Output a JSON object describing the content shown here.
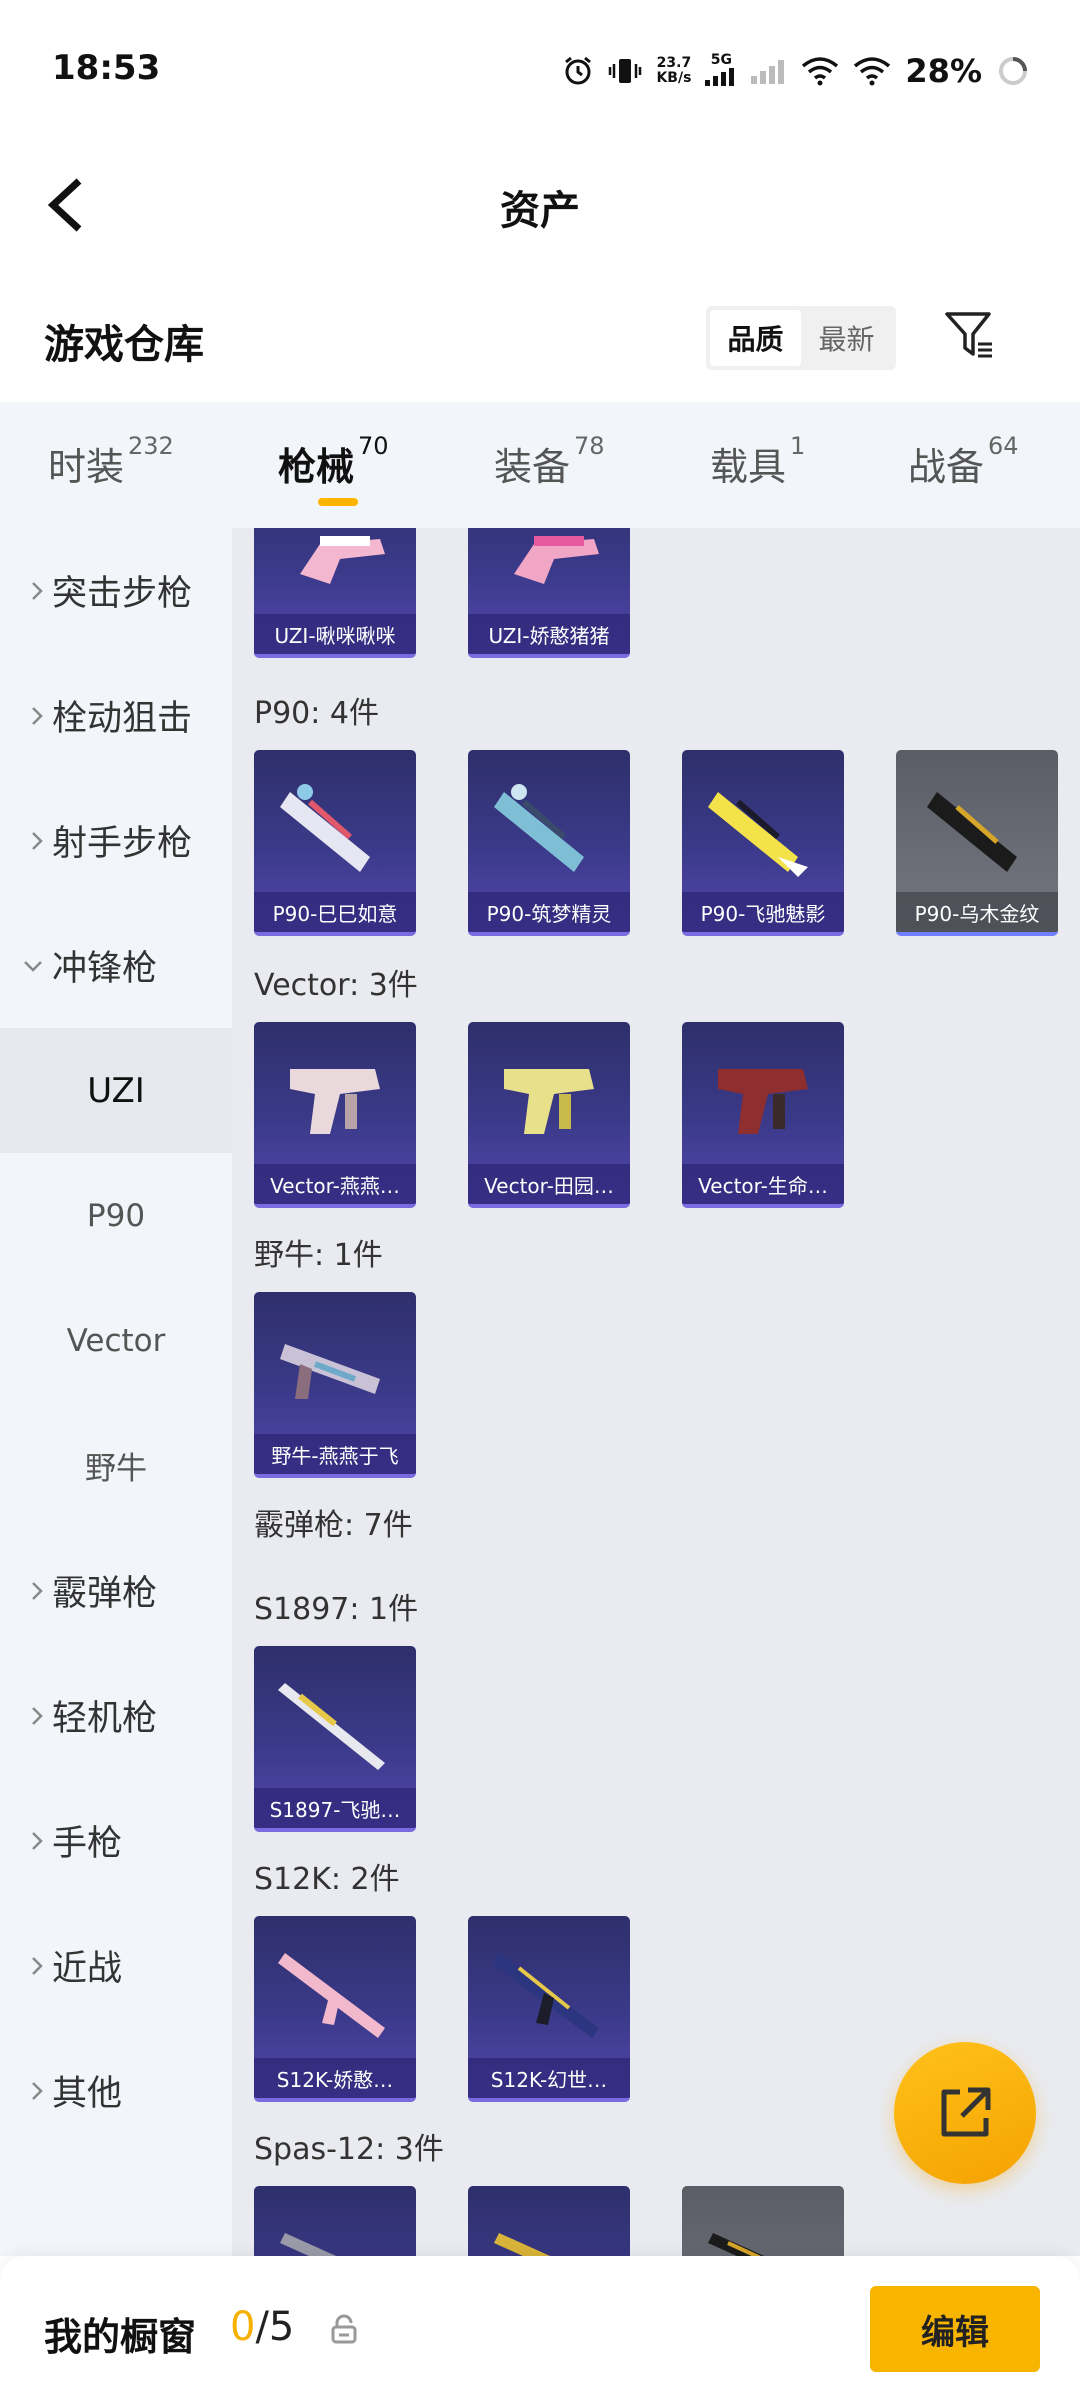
{
  "status": {
    "time": "18:53",
    "speed_value": "23.7",
    "speed_unit": "KB/s",
    "network": "5G",
    "battery": "28%"
  },
  "header": {
    "title": "资产"
  },
  "section": {
    "title": "游戏仓库",
    "sort_options": [
      "品质",
      "最新"
    ],
    "sort_selected": "品质"
  },
  "tabs": [
    {
      "label": "时装",
      "count": "232"
    },
    {
      "label": "枪械",
      "count": "70"
    },
    {
      "label": "装备",
      "count": "78"
    },
    {
      "label": "载具",
      "count": "1"
    },
    {
      "label": "战备",
      "count": "64"
    }
  ],
  "active_tab": "枪械",
  "sidebar": {
    "items": [
      {
        "label": "突击步枪"
      },
      {
        "label": "栓动狙击"
      },
      {
        "label": "射手步枪"
      },
      {
        "label": "冲锋枪"
      },
      {
        "label": "霰弹枪"
      },
      {
        "label": "轻机枪"
      },
      {
        "label": "手枪"
      },
      {
        "label": "近战"
      },
      {
        "label": "其他"
      }
    ],
    "subitems": [
      "UZI",
      "P90",
      "Vector",
      "野牛"
    ],
    "active_sub": "UZI"
  },
  "groups": [
    {
      "label": "",
      "cards": [
        "UZI-啾咪啾咪",
        "UZI-娇憨猪猪"
      ]
    },
    {
      "label": "P90: 4件",
      "cards": [
        "P90-巳巳如意",
        "P90-筑梦精灵",
        "P90-飞驰魅影",
        "P90-乌木金纹"
      ]
    },
    {
      "label": "Vector: 3件",
      "cards": [
        "Vector-燕燕…",
        "Vector-田园…",
        "Vector-生命…"
      ]
    },
    {
      "label": "野牛: 1件",
      "cards": [
        "野牛-燕燕于飞"
      ]
    },
    {
      "label": "霰弹枪: 7件",
      "cards": []
    },
    {
      "label": "S1897: 1件",
      "cards": [
        "S1897-飞驰…"
      ]
    },
    {
      "label": "S12K: 2件",
      "cards": [
        "S12K-娇憨…",
        "S12K-幻世…"
      ]
    },
    {
      "label": "Spas-12: 3件",
      "cards": []
    }
  ],
  "bottom": {
    "title": "我的橱窗",
    "used": "0",
    "total": "/5",
    "edit_label": "编辑"
  },
  "colors": {
    "accent": "#f7b500",
    "card_bg": "#3b3a8a",
    "sidebar_bg": "#f2f5fa",
    "content_bg": "#e9ebf0"
  }
}
